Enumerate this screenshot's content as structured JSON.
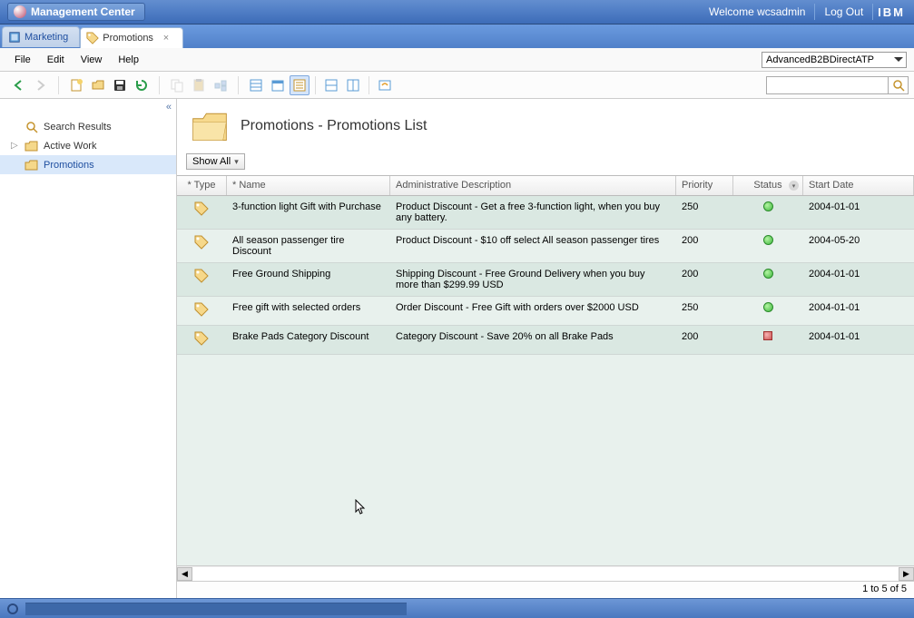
{
  "titlebar": {
    "title": "Management Center",
    "welcome": "Welcome wcsadmin",
    "logout": "Log Out",
    "brand": "IBM"
  },
  "tabs": [
    {
      "label": "Marketing",
      "active": false
    },
    {
      "label": "Promotions",
      "active": true
    }
  ],
  "menu": [
    "File",
    "Edit",
    "View",
    "Help"
  ],
  "store_selector": "AdvancedB2BDirectATP",
  "sidebar": {
    "items": [
      {
        "label": "Search Results",
        "icon": "search"
      },
      {
        "label": "Active Work",
        "icon": "folder-open",
        "expandable": true
      },
      {
        "label": "Promotions",
        "icon": "folder",
        "selected": true
      }
    ]
  },
  "main": {
    "title": "Promotions - Promotions List",
    "filter_label": "Show All",
    "columns": {
      "type": "* Type",
      "name": "* Name",
      "desc": "Administrative Description",
      "priority": "Priority",
      "status": "Status",
      "start": "Start Date"
    },
    "rows": [
      {
        "name": "3-function light Gift with Purchase",
        "desc": "Product Discount - Get a free 3-function light, when you buy any battery.",
        "priority": "250",
        "status": "active",
        "start": "2004-01-01"
      },
      {
        "name": "All season passenger tire Discount",
        "desc": "Product Discount - $10 off select All season passenger tires",
        "priority": "200",
        "status": "active",
        "start": "2004-05-20"
      },
      {
        "name": "Free Ground Shipping",
        "desc": "Shipping Discount - Free Ground Delivery when you buy more than $299.99 USD",
        "priority": "200",
        "status": "active",
        "start": "2004-01-01"
      },
      {
        "name": "Free gift with selected orders",
        "desc": "Order Discount - Free Gift with orders over $2000 USD",
        "priority": "250",
        "status": "active",
        "start": "2004-01-01"
      },
      {
        "name": "Brake Pads Category Discount",
        "desc": "Category Discount - Save 20% on all Brake Pads",
        "priority": "200",
        "status": "inactive",
        "start": "2004-01-01"
      }
    ],
    "footer": "1 to 5 of 5"
  }
}
